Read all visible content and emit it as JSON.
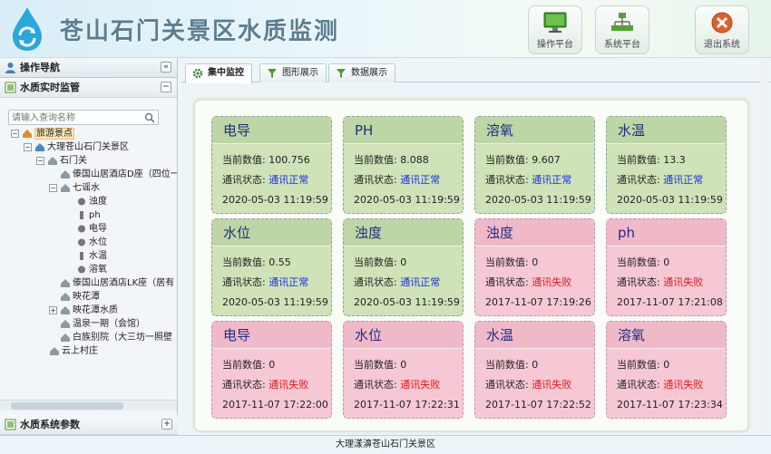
{
  "header": {
    "title": "苍山石门关景区水质监测",
    "buttons": [
      {
        "label": "操作平台",
        "icon": "monitor-icon"
      },
      {
        "label": "系统平台",
        "icon": "network-icon"
      },
      {
        "label": "退出系统",
        "icon": "exit-icon"
      }
    ]
  },
  "sidebar": {
    "nav_title": "操作导航",
    "section_title": "水质实时监管",
    "search_placeholder": "请输入查询名称",
    "tree": [
      "旅游景点",
      "大理苍山石门关景区",
      "石门关",
      "傣国山居酒店D座（四位一",
      "七谣水",
      "浊度",
      "ph",
      "电导",
      "水位",
      "水温",
      "溶氧",
      "傣国山居酒店LK座（居有",
      "映花潭",
      "映花潭水质",
      "温泉一期（会馆）",
      "白族别院（大三坊一照壁",
      "云上村庄"
    ],
    "bottom_section": "水质系统参数"
  },
  "tabs": [
    "集中监控",
    "图形展示",
    "数据展示"
  ],
  "card_labels": {
    "current": "当前数值: ",
    "status": "通讯状态: "
  },
  "cards": [
    {
      "name": "电导",
      "value": "100.756",
      "status": "通讯正常",
      "time": "2020-05-03 11:19:59",
      "ok": true
    },
    {
      "name": "PH",
      "value": "8.088",
      "status": "通讯正常",
      "time": "2020-05-03 11:19:59",
      "ok": true
    },
    {
      "name": "溶氧",
      "value": "9.607",
      "status": "通讯正常",
      "time": "2020-05-03 11:19:59",
      "ok": true
    },
    {
      "name": "水温",
      "value": "13.3",
      "status": "通讯正常",
      "time": "2020-05-03 11:19:59",
      "ok": true
    },
    {
      "name": "水位",
      "value": "0.55",
      "status": "通讯正常",
      "time": "2020-05-03 11:19:59",
      "ok": true
    },
    {
      "name": "浊度",
      "value": "0",
      "status": "通讯正常",
      "time": "2020-05-03 11:19:59",
      "ok": true
    },
    {
      "name": "浊度",
      "value": "0",
      "status": "通讯失败",
      "time": "2017-11-07 17:19:26",
      "ok": false
    },
    {
      "name": "ph",
      "value": "0",
      "status": "通讯失败",
      "time": "2017-11-07 17:21:08",
      "ok": false
    },
    {
      "name": "电导",
      "value": "0",
      "status": "通讯失败",
      "time": "2017-11-07 17:22:00",
      "ok": false
    },
    {
      "name": "水位",
      "value": "0",
      "status": "通讯失败",
      "time": "2017-11-07 17:22:31",
      "ok": false
    },
    {
      "name": "水温",
      "value": "0",
      "status": "通讯失败",
      "time": "2017-11-07 17:22:52",
      "ok": false
    },
    {
      "name": "溶氧",
      "value": "0",
      "status": "通讯失败",
      "time": "2017-11-07 17:23:34",
      "ok": false
    }
  ],
  "footer": "大理漾濞苍山石门关景区",
  "colors": {
    "ok_card": "#cfe2b8",
    "err_card": "#f6c8d4",
    "status_ok": "#1a2fe0",
    "status_err": "#e6171e",
    "card_title": "#1f2f80"
  }
}
